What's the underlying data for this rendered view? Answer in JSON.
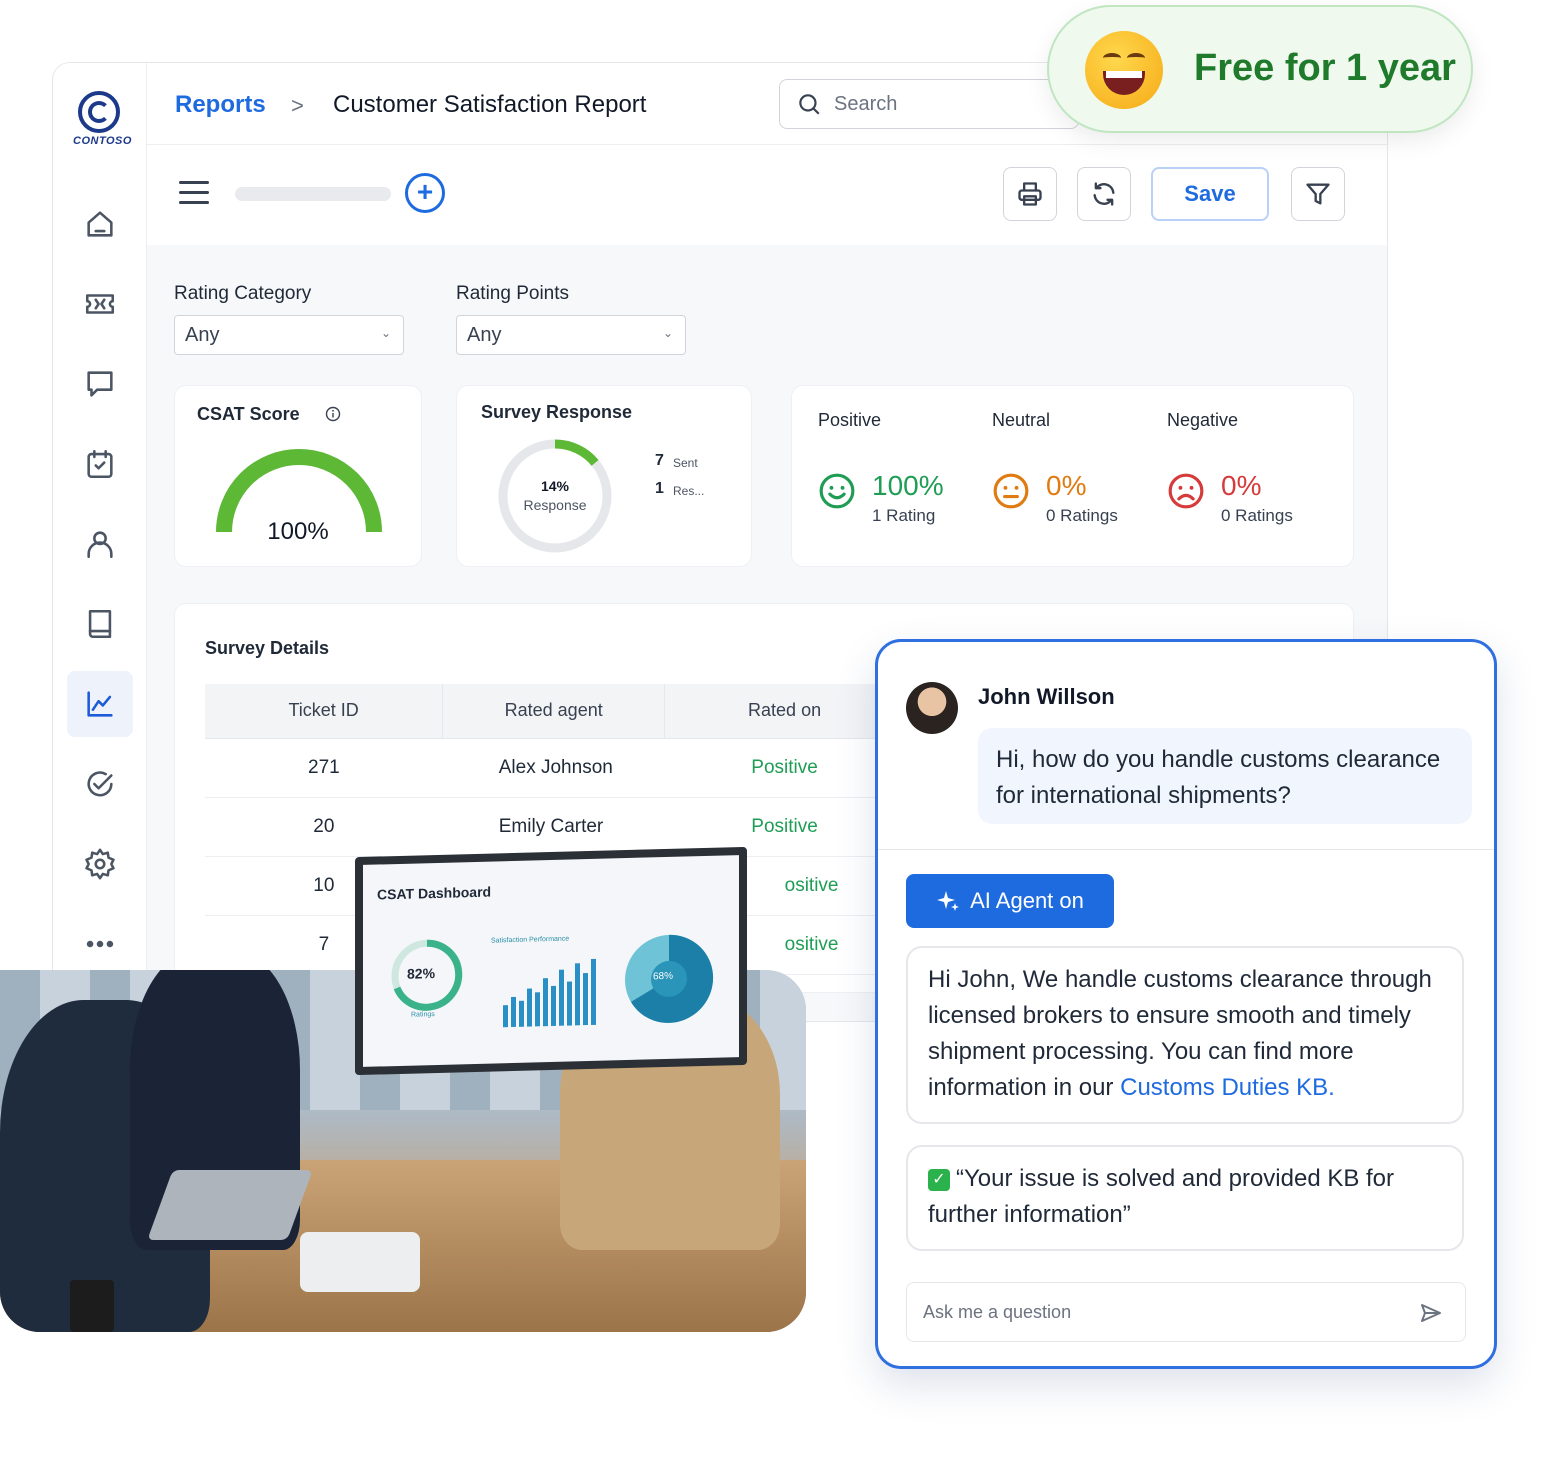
{
  "breadcrumb": {
    "link": "Reports",
    "separator": ">",
    "title": "Customer Satisfaction Report"
  },
  "search": {
    "placeholder": "Search"
  },
  "logo": {
    "text": "CONTOSO"
  },
  "toolbar": {
    "save_label": "Save"
  },
  "filters": {
    "rating_category": {
      "label": "Rating Category",
      "value": "Any"
    },
    "rating_points": {
      "label": "Rating Points",
      "value": "Any"
    }
  },
  "csat": {
    "title": "CSAT Score",
    "value": "100%",
    "fill": 1.0,
    "color": "#5db935"
  },
  "survey": {
    "title": "Survey Response",
    "percent": "14%",
    "percent_label": "Response",
    "fill": 0.14,
    "sent_count": "7",
    "sent_label": "Sent",
    "res_count": "1",
    "res_label": "Res..."
  },
  "sentiment": [
    {
      "label": "Positive",
      "percent": "100%",
      "ratings": "1 Rating",
      "color": "#1f9d55",
      "icon": "smile-icon"
    },
    {
      "label": "Neutral",
      "percent": "0%",
      "ratings": "0 Ratings",
      "color": "#e07b12",
      "icon": "neutral-face-icon"
    },
    {
      "label": "Negative",
      "percent": "0%",
      "ratings": "0 Ratings",
      "color": "#d63a3a",
      "icon": "sad-face-icon"
    }
  ],
  "survey_details": {
    "title": "Survey Details",
    "columns": [
      "Ticket ID",
      "Rated agent",
      "Rated on"
    ],
    "rows": [
      {
        "ticket": "271",
        "agent": "Alex Johnson",
        "rating": "Positive"
      },
      {
        "ticket": "20",
        "agent": "Emily Carter",
        "rating": "Positive"
      },
      {
        "ticket": "10",
        "agent": "",
        "rating": "ositive"
      },
      {
        "ticket": "7",
        "agent": "",
        "rating": "ositive"
      }
    ]
  },
  "badge": {
    "text": "Free for 1 year"
  },
  "photo": {
    "monitor_title": "CSAT Dashboard",
    "monitor_subtitle": "Satisfaction Performance",
    "ring_value": "82%",
    "ring_label": "Ratings",
    "pie_value": "68%"
  },
  "chat": {
    "user_name": "John Willson",
    "user_message": "Hi, how do you handle customs clearance for international shipments?",
    "ai_button": "AI Agent on",
    "bot_message": "Hi John, We handle customs clearance through licensed brokers to ensure smooth and timely shipment processing. You can find more information in our",
    "kb_link": "Customs Duties KB.",
    "resolution": "“Your issue is solved and provided KB for further information”",
    "input_placeholder": "Ask me a question"
  },
  "colors": {
    "accent": "#1e6be0",
    "positive": "#1f9d55",
    "neutral": "#e07b12",
    "negative": "#d63a3a"
  }
}
